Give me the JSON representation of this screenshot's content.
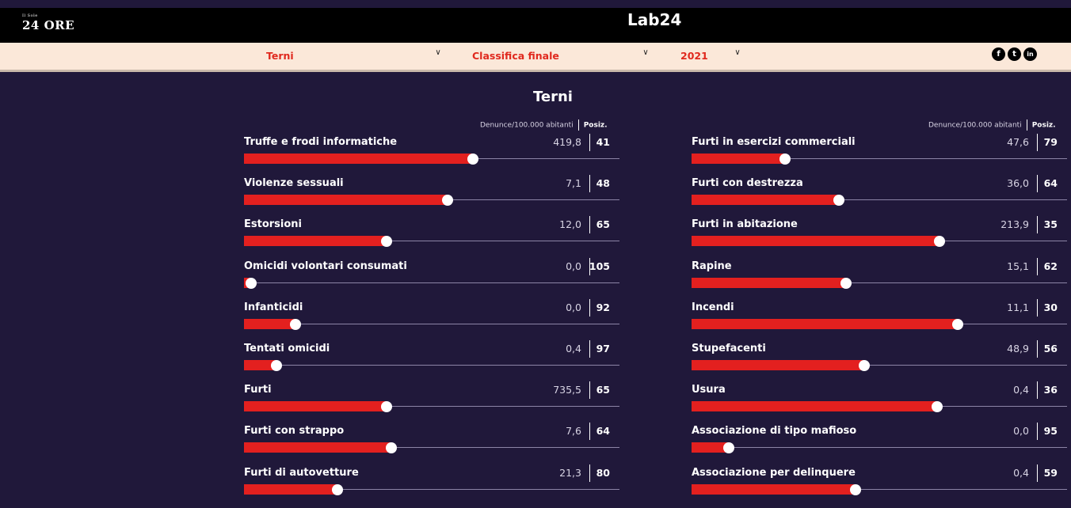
{
  "header": {
    "brand_small": "Il Sole",
    "brand": "24 ORE",
    "lab": "Lab24"
  },
  "filters": {
    "city": "Terni",
    "ranking": "Classifica finale",
    "year": "2021"
  },
  "social": [
    "f",
    "t",
    "in"
  ],
  "title": "Terni",
  "column_headers": {
    "metric": "Denunce/100.000 abitanti",
    "position": "Posiz."
  },
  "colors": {
    "bar": "#e3201f",
    "background": "#20183a",
    "filterbar": "#fbe8d9",
    "accent_text": "#e0291e"
  },
  "left_items": [
    {
      "label": "Truffe e frodi informatiche",
      "value": "419,8",
      "position": "41",
      "fill": 0.98
    },
    {
      "label": "Violenze sessuali",
      "value": "7,1",
      "position": "48",
      "fill": 0.87
    },
    {
      "label": "Estorsioni",
      "value": "12,0",
      "position": "65",
      "fill": 0.61
    },
    {
      "label": "Omicidi volontari consumati",
      "value": "0,0",
      "position": "105",
      "fill": 0.03
    },
    {
      "label": "Infanticidi",
      "value": "0,0",
      "position": "92",
      "fill": 0.22
    },
    {
      "label": "Tentati omicidi",
      "value": "0,4",
      "position": "97",
      "fill": 0.14
    },
    {
      "label": "Furti",
      "value": "735,5",
      "position": "65",
      "fill": 0.61
    },
    {
      "label": "Furti con strappo",
      "value": "7,6",
      "position": "64",
      "fill": 0.63
    },
    {
      "label": "Furti di autovetture",
      "value": "21,3",
      "position": "80",
      "fill": 0.4
    }
  ],
  "right_items": [
    {
      "label": "Furti in esercizi commerciali",
      "value": "47,6",
      "position": "79",
      "fill": 0.4
    },
    {
      "label": "Furti con destrezza",
      "value": "36,0",
      "position": "64",
      "fill": 0.63
    },
    {
      "label": "Furti in abitazione",
      "value": "213,9",
      "position": "35",
      "fill": 1.06
    },
    {
      "label": "Rapine",
      "value": "15,1",
      "position": "62",
      "fill": 0.66
    },
    {
      "label": "Incendi",
      "value": "11,1",
      "position": "30",
      "fill": 1.14
    },
    {
      "label": "Stupefacenti",
      "value": "48,9",
      "position": "56",
      "fill": 0.74
    },
    {
      "label": "Usura",
      "value": "0,4",
      "position": "36",
      "fill": 1.05
    },
    {
      "label": "Associazione di tipo mafioso",
      "value": "0,0",
      "position": "95",
      "fill": 0.16
    },
    {
      "label": "Associazione per delinquere",
      "value": "0,4",
      "position": "59",
      "fill": 0.7
    }
  ]
}
